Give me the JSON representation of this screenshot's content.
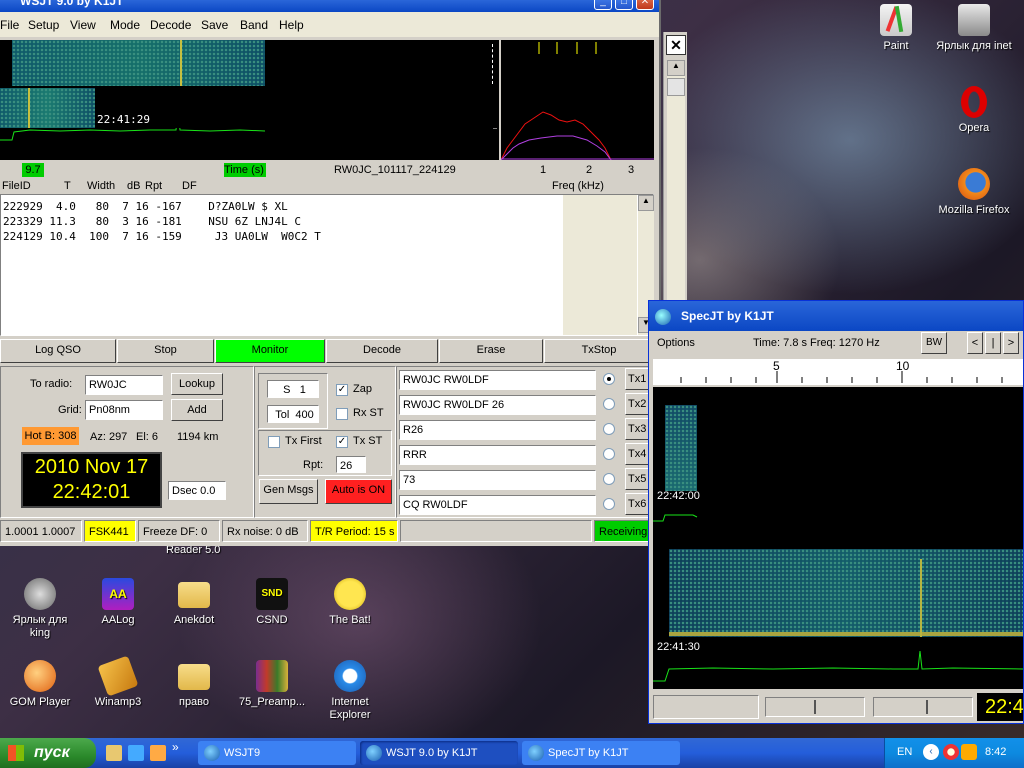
{
  "wsjt": {
    "title": "WSJT 9.0    by K1JT",
    "menu": [
      "File",
      "Setup",
      "View",
      "Mode",
      "Decode",
      "Save",
      "Band",
      "Help"
    ],
    "waterfall_time": "22:41:29",
    "level": "9.7",
    "time_label": "Time (s)",
    "file_name": "RW0JC_101117_224129",
    "freq_ticks": [
      "1",
      "2",
      "3"
    ],
    "freq_label": "Freq (kHz)",
    "decode_headers": [
      "FileID",
      "T",
      "Width",
      "dB",
      "Rpt",
      "DF"
    ],
    "decode_rows": [
      "222929  4.0   80  7 16 -167    D?ZA0LW $ XL",
      "223329 11.3   80  3 16 -181    NSU 6Z LNJ4L C",
      "224129 10.4  100  7 16 -159     J3 UA0LW  W0C2 T"
    ],
    "buttons": {
      "log_qso": "Log QSO",
      "stop": "Stop",
      "monitor": "Monitor",
      "decode": "Decode",
      "erase": "Erase",
      "txstop": "TxStop"
    },
    "to_radio_label": "To radio:",
    "to_radio": "RW0JC",
    "lookup": "Lookup",
    "grid_label": "Grid:",
    "grid": "Pn08nm",
    "add": "Add",
    "hot_b": "Hot B: 308",
    "az": "Az: 297",
    "el": "El: 6",
    "dist": "1194 km",
    "date": "2010 Nov 17",
    "time": "22:42:01",
    "s_label": "S",
    "s_value": "1",
    "tol_label": "Tol",
    "tol_value": "400",
    "zap": "Zap",
    "rx_st": "Rx ST",
    "tx_first": "Tx First",
    "tx_st": "Tx ST",
    "rpt_label": "Rpt:",
    "rpt_value": "26",
    "dsec": "Dsec  0.0",
    "gen_msgs": "Gen Msgs",
    "auto_is_on": "Auto is  ON",
    "messages": [
      "RW0JC RW0LDF",
      "RW0JC RW0LDF 26",
      "R26",
      "RRR",
      "73",
      "CQ RW0LDF"
    ],
    "tx_labels": [
      "Tx1",
      "Tx2",
      "Tx3",
      "Tx4",
      "Tx5",
      "Tx6"
    ],
    "status": {
      "freq": "1.0001 1.0007",
      "mode": "FSK441",
      "freeze": "Freeze DF:    0",
      "rx_noise": "Rx noise:  0 dB",
      "tr_period": "T/R Period: 15 s",
      "receiving": "Receiving"
    },
    "colors": {
      "monitor": "#00ff00",
      "auto": "#ff2020",
      "hot_b": "#ff9933",
      "mode": "#ffff00",
      "receiving": "#00cc00"
    }
  },
  "desktop": {
    "icons": [
      {
        "label": "Paint",
        "icon": "paint-icon"
      },
      {
        "label": "Ярлык для inet",
        "icon": "network-icon"
      },
      {
        "label": "Opera",
        "icon": "opera-icon"
      },
      {
        "label": "Mozilla Firefox",
        "icon": "firefox-icon"
      },
      {
        "label": "Reader 5.0",
        "icon": "reader-icon"
      },
      {
        "label": "Ярлык для king",
        "icon": "shortcut-icon"
      },
      {
        "label": "AALog",
        "icon": "aalog-icon"
      },
      {
        "label": "Anekdot",
        "icon": "folder-icon"
      },
      {
        "label": "CSND",
        "icon": "csnd-icon"
      },
      {
        "label": "The Bat!",
        "icon": "bat-icon"
      },
      {
        "label": "GOM Player",
        "icon": "gom-icon"
      },
      {
        "label": "Winamp3",
        "icon": "winamp-icon"
      },
      {
        "label": "право",
        "icon": "folder-icon"
      },
      {
        "label": "75_Preamp...",
        "icon": "archive-icon"
      },
      {
        "label": "Internet Explorer",
        "icon": "ie-icon"
      }
    ]
  },
  "specjt": {
    "title": "SpecJT     by K1JT",
    "options": "Options",
    "time_freq": "Time:  7.8 s  Freq: 1270 Hz",
    "bw": "BW",
    "nav": [
      "<",
      "|",
      ">"
    ],
    "scale": [
      "5",
      "10"
    ],
    "time_top": "22:42:00",
    "time_bottom": "22:41:30",
    "clock": "22:4"
  },
  "taskbar": {
    "start": "пуск",
    "items": [
      "WSJT9",
      "WSJT 9.0    by K1JT",
      "SpecJT    by K1JT"
    ],
    "lang": "EN",
    "clock": "8:42"
  }
}
